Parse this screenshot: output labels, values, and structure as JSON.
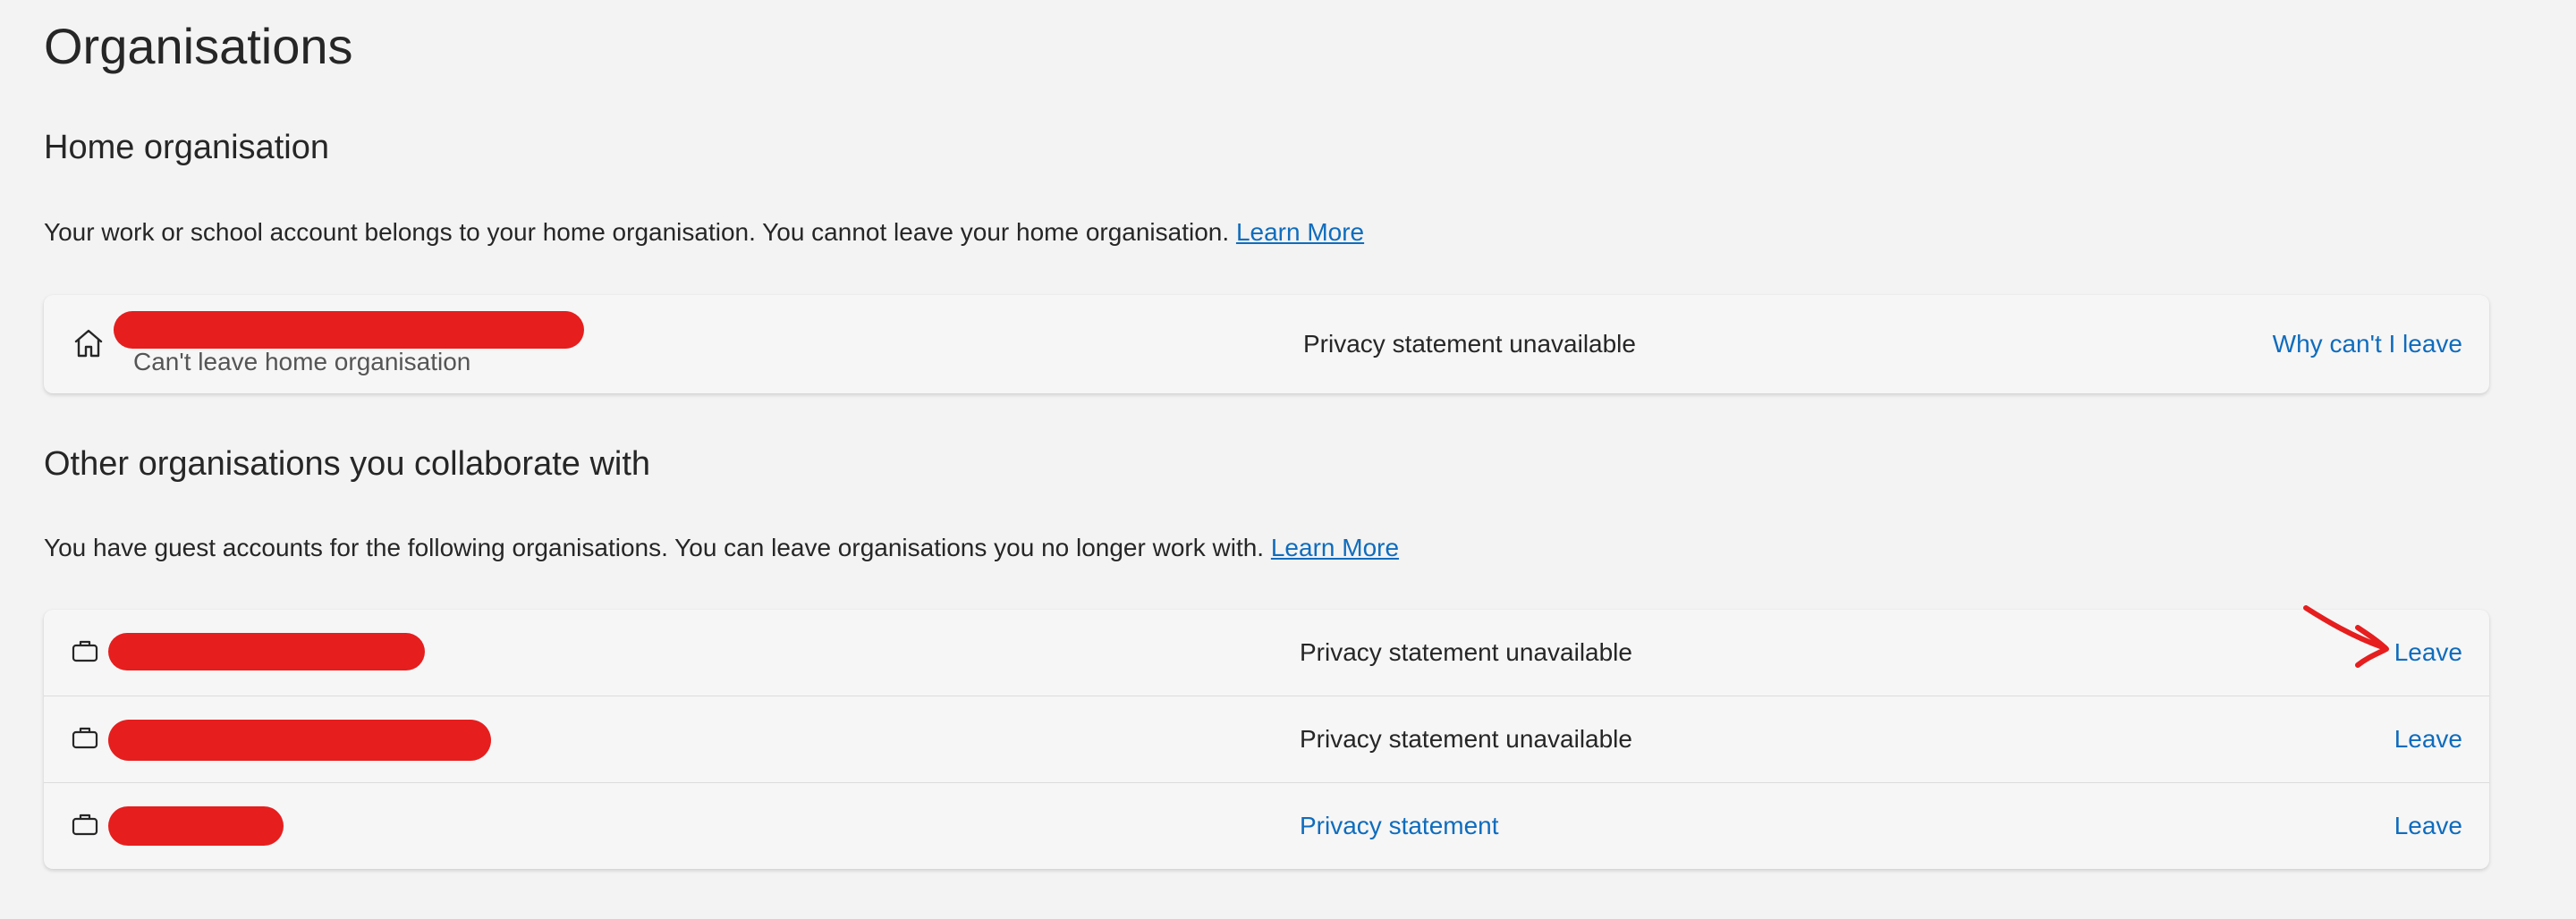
{
  "page": {
    "title": "Organisations"
  },
  "home_section": {
    "title": "Home organisation",
    "description": "Your work or school account belongs to your home organisation. You cannot leave your home organisation.",
    "learn_more": "Learn More",
    "org": {
      "icon": "home-icon",
      "subtext": "Can't leave home organisation",
      "privacy": "Privacy statement unavailable",
      "action": "Why can't I leave"
    }
  },
  "other_section": {
    "title": "Other organisations you collaborate with",
    "description": "You have guest accounts for the following organisations. You can leave organisations you no longer work with.",
    "learn_more": "Learn More",
    "orgs": [
      {
        "icon": "briefcase-icon",
        "privacy": "Privacy statement unavailable",
        "privacy_is_link": false,
        "action": "Leave"
      },
      {
        "icon": "briefcase-icon",
        "privacy": "Privacy statement unavailable",
        "privacy_is_link": false,
        "action": "Leave"
      },
      {
        "icon": "briefcase-icon",
        "privacy": "Privacy statement",
        "privacy_is_link": true,
        "action": "Leave"
      }
    ]
  },
  "colors": {
    "background": "#f3f3f3",
    "link": "#0f6cbd",
    "redaction": "#e61e1e"
  }
}
